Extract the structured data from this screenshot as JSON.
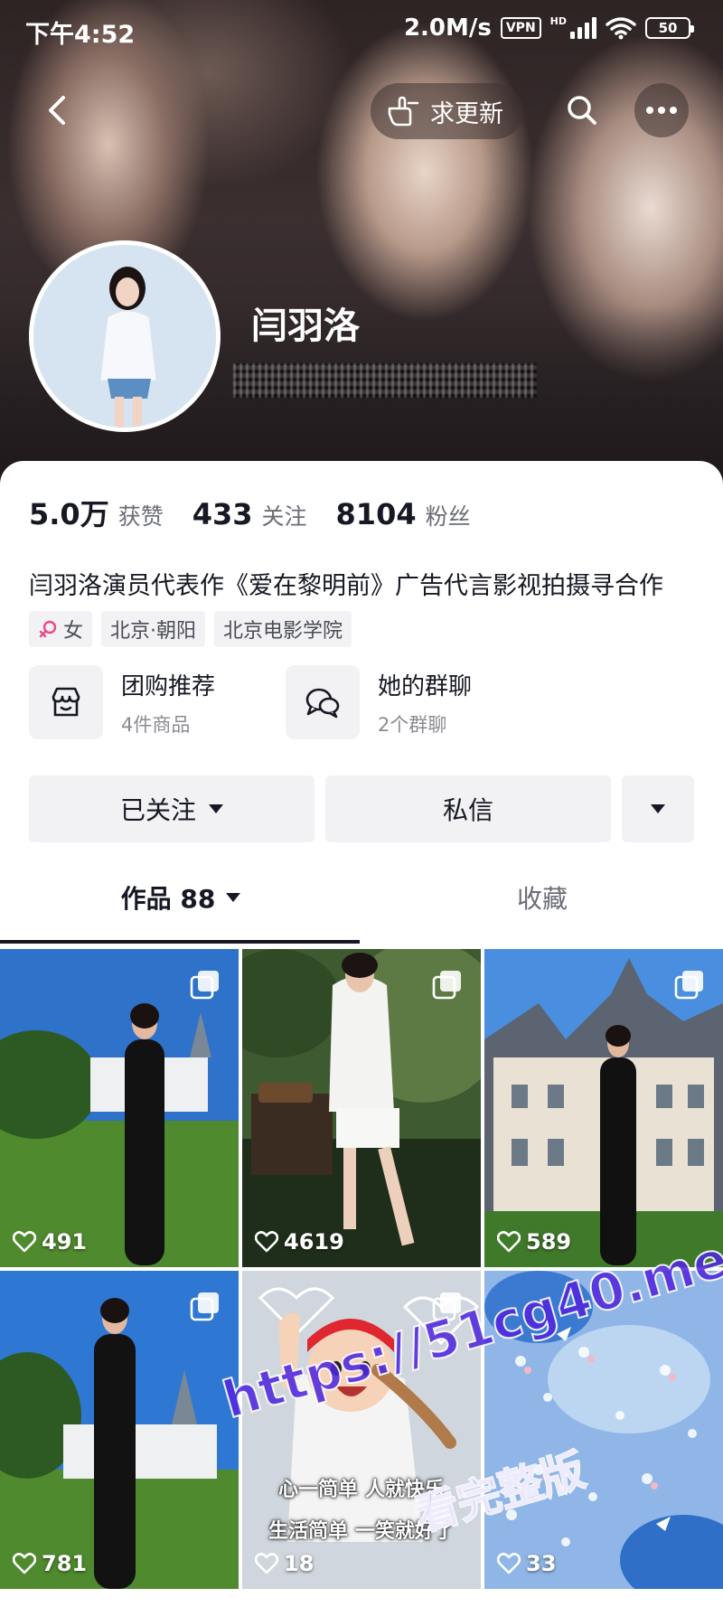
{
  "status_bar": {
    "time": "下午4:52",
    "network_speed": "2.0M/s",
    "vpn": "VPN",
    "hd": "HD",
    "battery": "50"
  },
  "nav": {
    "request_update": "求更新"
  },
  "profile": {
    "name": "闫羽洛",
    "stats": [
      {
        "value": "5.0万",
        "label": "获赞"
      },
      {
        "value": "433",
        "label": "关注"
      },
      {
        "value": "8104",
        "label": "粉丝"
      }
    ],
    "bio": "闫羽洛演员代表作《爱在黎明前》广告代言影视拍摄寻合作",
    "tags": {
      "gender": "女",
      "location": "北京·朝阳",
      "school": "北京电影学院"
    },
    "features": [
      {
        "title": "团购推荐",
        "subtitle": "4件商品",
        "icon": "shop-icon"
      },
      {
        "title": "她的群聊",
        "subtitle": "2个群聊",
        "icon": "chat-icon"
      }
    ],
    "actions": {
      "followed": "已关注",
      "message": "私信"
    }
  },
  "tabs": {
    "works": "作品 88",
    "favorites": "收藏"
  },
  "videos": [
    {
      "likes": "491",
      "multi": true,
      "theme": "castle-lawn"
    },
    {
      "likes": "4619",
      "multi": true,
      "theme": "garden"
    },
    {
      "likes": "589",
      "multi": true,
      "theme": "chateau"
    },
    {
      "likes": "781",
      "multi": true,
      "theme": "castle-lawn"
    },
    {
      "likes": "18",
      "multi": true,
      "theme": "cartoon",
      "caption_1": "心一简单 人就快乐",
      "caption_2": "生活简单 一笑就好了"
    },
    {
      "likes": "33",
      "multi": false,
      "theme": "blossom"
    }
  ],
  "watermark": {
    "url": "https://51cg40.me",
    "text": "看完整版"
  },
  "colors": {
    "text_primary": "#161823",
    "text_secondary": "#6b6d76",
    "chip_bg": "#f2f2f4",
    "gender_icon": "#e94b8a"
  }
}
